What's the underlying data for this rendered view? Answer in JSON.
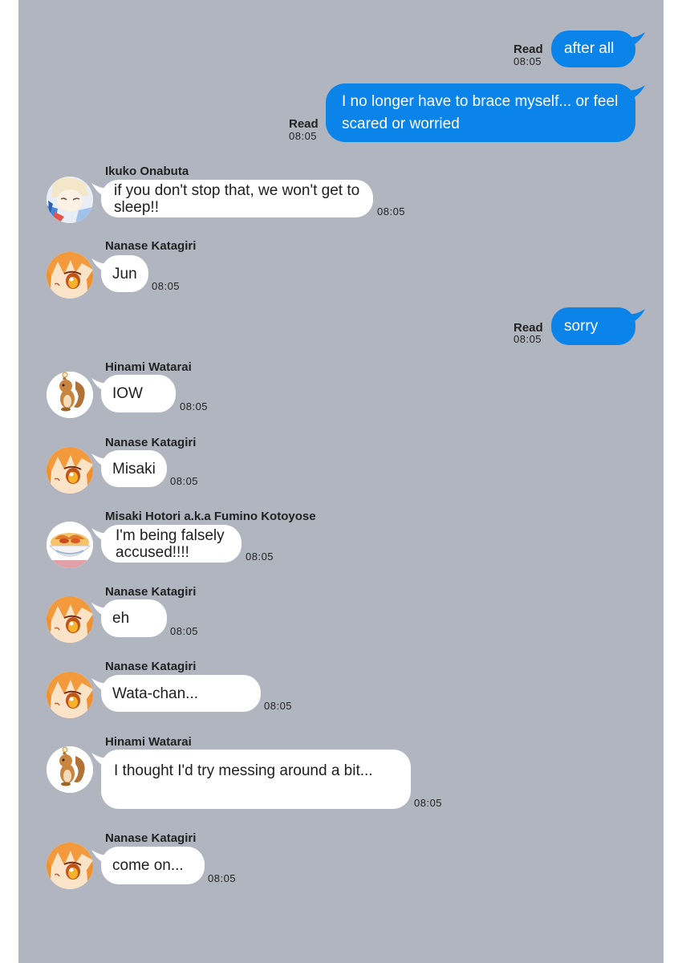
{
  "chat": {
    "outgoing": [
      {
        "text": "after all",
        "status": "Read",
        "time": "08:05"
      },
      {
        "text": "I no longer have to brace myself... or feel\nscared or worried",
        "status": "Read",
        "time": "08:05"
      },
      {
        "text": "sorry",
        "status": "Read",
        "time": "08:05"
      }
    ],
    "incoming": [
      {
        "sender": "Ikuko Onabuta",
        "text": "if you don't stop that, we won't get to\nsleep!!",
        "time": "08:05",
        "avatar": "ikuko-avatar"
      },
      {
        "sender": "Nanase Katagiri",
        "text": "Jun",
        "time": "08:05",
        "avatar": "nanase-avatar"
      },
      {
        "sender": "Hinami Watarai",
        "text": "IOW",
        "time": "08:05",
        "avatar": "squirrel-avatar"
      },
      {
        "sender": "Nanase Katagiri",
        "text": "Misaki",
        "time": "08:05",
        "avatar": "nanase-avatar"
      },
      {
        "sender": "Misaki Hotori a.k.a Fumino Kotoyose",
        "text": "I'm being falsely\naccused!!!!",
        "time": "08:05",
        "avatar": "food-avatar"
      },
      {
        "sender": "Nanase Katagiri",
        "text": "eh",
        "time": "08:05",
        "avatar": "nanase-avatar"
      },
      {
        "sender": "Nanase Katagiri",
        "text": "Wata-chan...",
        "time": "08:05",
        "avatar": "nanase-avatar"
      },
      {
        "sender": "Hinami Watarai",
        "text": "I thought I'd try messing around a bit...",
        "time": "08:05",
        "avatar": "squirrel-avatar"
      },
      {
        "sender": "Nanase Katagiri",
        "text": "come on...",
        "time": "08:05",
        "avatar": "nanase-avatar"
      }
    ]
  },
  "colors": {
    "background": "#b1b5c0",
    "outgoing_bubble": "#0a84e8",
    "incoming_bubble": "#ffffff"
  }
}
